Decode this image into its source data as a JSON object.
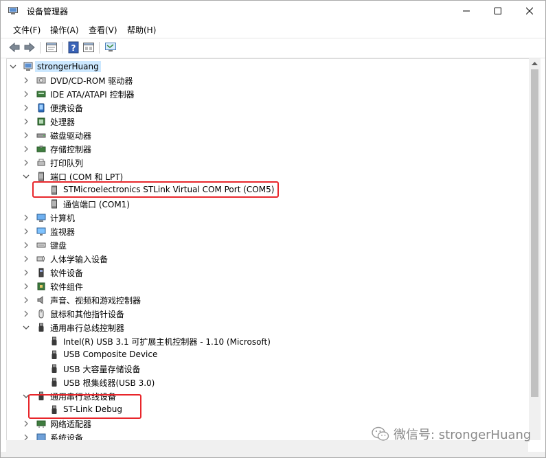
{
  "window": {
    "title": "设备管理器"
  },
  "menu": [
    "文件(F)",
    "操作(A)",
    "查看(V)",
    "帮助(H)"
  ],
  "tree": {
    "root": "strongerHuang",
    "items": [
      {
        "label": "DVD/CD-ROM 驱动器",
        "icon": "dvd-icon"
      },
      {
        "label": "IDE ATA/ATAPI 控制器",
        "icon": "ide-controller-icon"
      },
      {
        "label": "便携设备",
        "icon": "portable-device-icon"
      },
      {
        "label": "处理器",
        "icon": "processor-icon"
      },
      {
        "label": "磁盘驱动器",
        "icon": "disk-drive-icon"
      },
      {
        "label": "存储控制器",
        "icon": "storage-controller-icon"
      },
      {
        "label": "打印队列",
        "icon": "printer-icon"
      },
      {
        "label": "端口 (COM 和 LPT)",
        "icon": "port-icon",
        "expanded": true,
        "children": [
          {
            "label": "STMicroelectronics STLink Virtual COM Port (COM5)",
            "icon": "port-icon"
          },
          {
            "label": "通信端口 (COM1)",
            "icon": "port-icon"
          }
        ]
      },
      {
        "label": "计算机",
        "icon": "computer-icon"
      },
      {
        "label": "监视器",
        "icon": "monitor-icon"
      },
      {
        "label": "键盘",
        "icon": "keyboard-icon"
      },
      {
        "label": "人体学输入设备",
        "icon": "hid-icon"
      },
      {
        "label": "软件设备",
        "icon": "software-device-icon"
      },
      {
        "label": "软件组件",
        "icon": "software-component-icon"
      },
      {
        "label": "声音、视频和游戏控制器",
        "icon": "sound-icon"
      },
      {
        "label": "鼠标和其他指针设备",
        "icon": "mouse-icon"
      },
      {
        "label": "通用串行总线控制器",
        "icon": "usb-icon",
        "expanded": true,
        "children": [
          {
            "label": "Intel(R) USB 3.1 可扩展主机控制器 - 1.10 (Microsoft)",
            "icon": "usb-icon"
          },
          {
            "label": "USB Composite Device",
            "icon": "usb-icon"
          },
          {
            "label": "USB 大容量存储设备",
            "icon": "usb-icon"
          },
          {
            "label": "USB 根集线器(USB 3.0)",
            "icon": "usb-icon"
          }
        ]
      },
      {
        "label": "通用串行总线设备",
        "icon": "usb-icon",
        "expanded": true,
        "children": [
          {
            "label": "ST-Link Debug",
            "icon": "usb-icon"
          }
        ]
      },
      {
        "label": "网络适配器",
        "icon": "network-adapter-icon"
      },
      {
        "label": "系统设备",
        "icon": "system-device-icon"
      }
    ]
  },
  "watermark": "微信号: strongerHuang"
}
